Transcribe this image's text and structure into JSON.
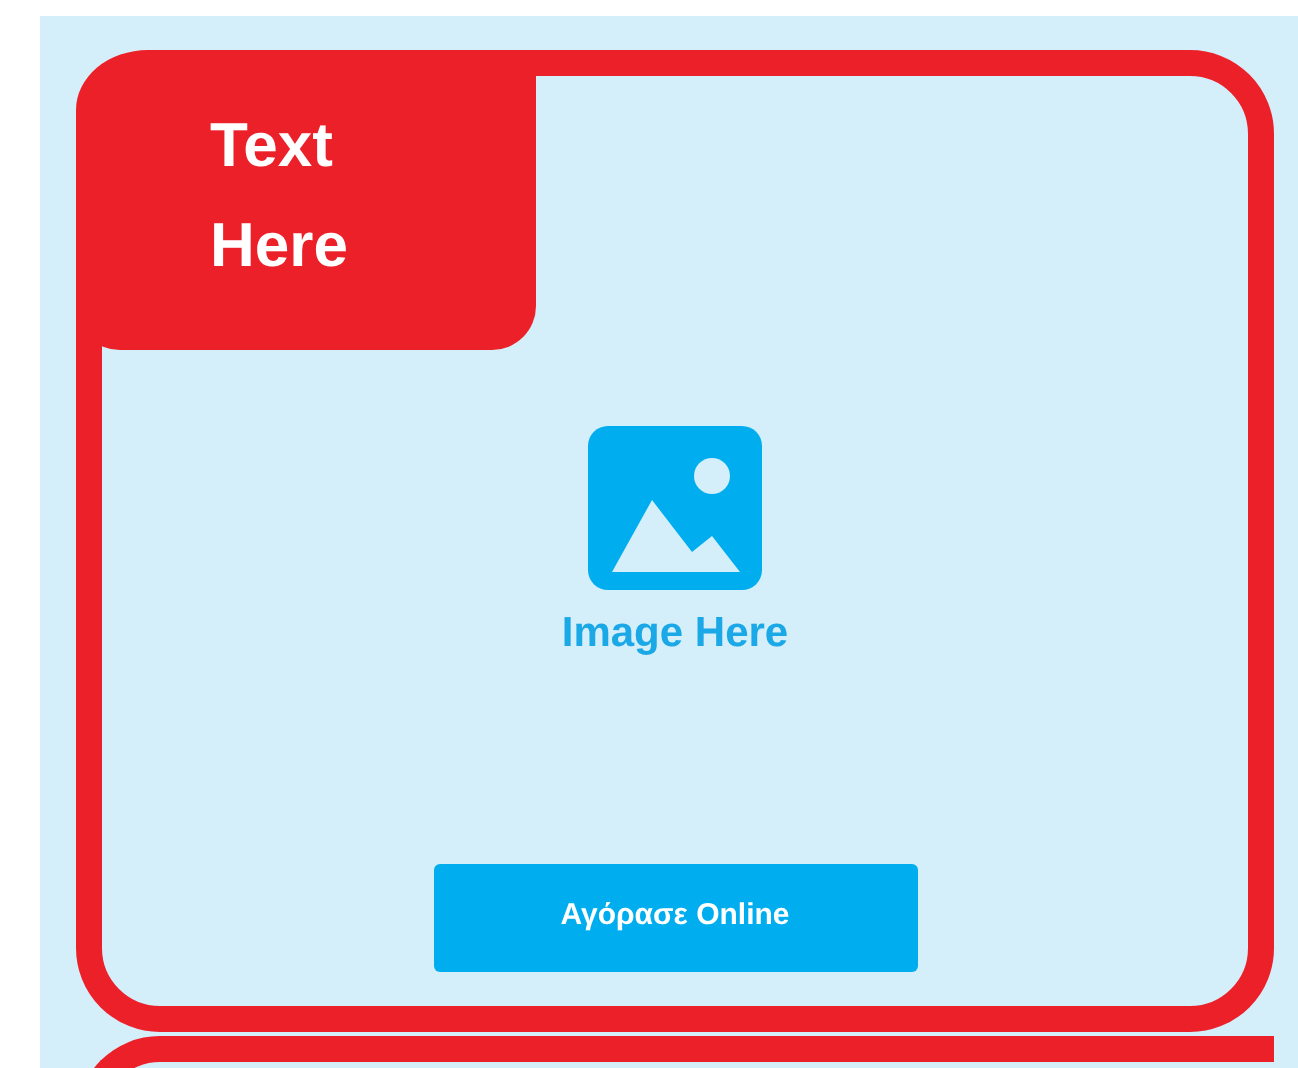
{
  "card": {
    "label": "Text Here",
    "image_caption": "Image Here",
    "button": "Αγόρασε Online"
  }
}
